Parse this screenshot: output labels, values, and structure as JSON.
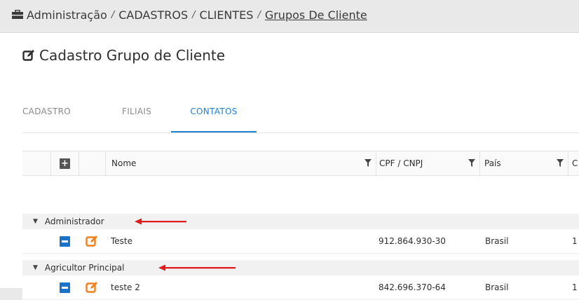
{
  "breadcrumb": {
    "items": [
      "Administração",
      "CADASTROS",
      "CLIENTES",
      "Grupos De Cliente"
    ],
    "separator": "/"
  },
  "page": {
    "title": "Cadastro Grupo de Cliente"
  },
  "tabs": [
    {
      "label": "CADASTRO",
      "active": false
    },
    {
      "label": "FILIAIS",
      "active": false
    },
    {
      "label": "CONTATOS",
      "active": true
    }
  ],
  "grid": {
    "columns": [
      "Nome",
      "CPF / CNPJ",
      "País",
      "C"
    ],
    "groups": [
      {
        "label": "Administrador",
        "rows": [
          {
            "nome": "Teste",
            "cpf": "912.864.930-30",
            "pais": "Brasil",
            "extra": "1"
          }
        ]
      },
      {
        "label": "Agricultor Principal",
        "rows": [
          {
            "nome": "teste 2",
            "cpf": "842.696.370-64",
            "pais": "Brasil",
            "extra": "1"
          }
        ]
      }
    ]
  },
  "colors": {
    "accent": "#1f7fd1",
    "minus": "#1a73c8",
    "edit": "#f0801f",
    "arrow": "#e01b1b"
  },
  "icons": [
    "briefcase-icon",
    "edit-icon",
    "plus-icon",
    "minus-icon",
    "filter-icon",
    "caret-down-icon",
    "arrow-left-icon"
  ]
}
